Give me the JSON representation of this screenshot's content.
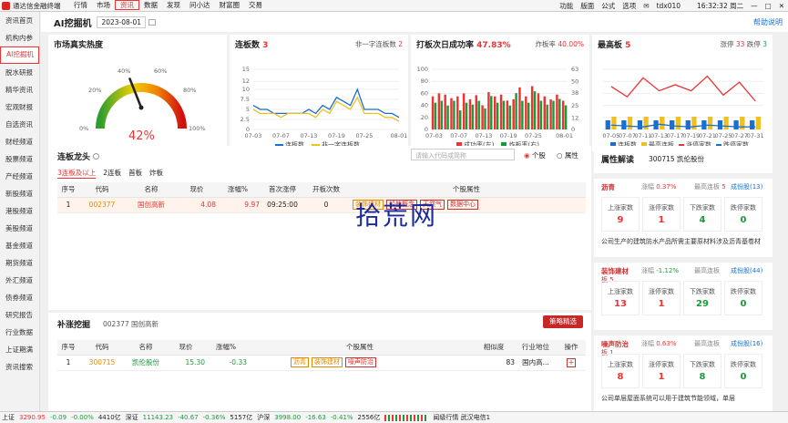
{
  "titlebar": {
    "app_name": "通达信金融终端",
    "menu": [
      "行情",
      "市场",
      "资讯",
      "数据",
      "发现",
      "问小达",
      "财富圈",
      "交易"
    ],
    "right_items": [
      "功能",
      "版面",
      "公式",
      "选项"
    ],
    "account": "tdx010",
    "clock": "16:32:32 周二"
  },
  "sidebar": {
    "items": [
      "资讯首页",
      "机构内参",
      "AI挖掘机",
      "脱水研报",
      "精华资讯",
      "宏观财报",
      "自选资讯",
      "财经频道",
      "股票频道",
      "产经频道",
      "新股频道",
      "港股频道",
      "美股频道",
      "基金频道",
      "期货频道",
      "外汇频道",
      "债券频道",
      "研究报告",
      "行业数据",
      "上证期满",
      "资讯搜索"
    ]
  },
  "topbar": {
    "title": "AI挖掘机",
    "date": "2023-08-01",
    "help": "帮助说明"
  },
  "heat": {
    "title": "市场真实热度",
    "ticks": [
      "0%",
      "20%",
      "40%",
      "60%",
      "80%",
      "100%"
    ],
    "value": "42%",
    "value_num": 42
  },
  "limit_count": {
    "title": "连板数",
    "count": "3",
    "right_label": "非一字连板数",
    "right_count": "2",
    "legend": [
      "连板数",
      "非一字连板数"
    ]
  },
  "next_day": {
    "title": "打板次日成功率",
    "pct": "47.83%",
    "right_label": "炸板率",
    "right_pct": "40.00%",
    "legend": [
      "成功率(左)",
      "炸板率(右)"
    ]
  },
  "highest": {
    "title": "最高板",
    "count": "5",
    "up_label": "涨停",
    "up": "33",
    "down_label": "跌停",
    "down": "3",
    "legend": [
      "连板数",
      "最高连板",
      "涨停家数",
      "跌停家数"
    ]
  },
  "chart_data": [
    {
      "type": "line",
      "title": "连板数",
      "x": [
        "07-03",
        "07-04",
        "07-05",
        "07-06",
        "07-07",
        "07-10",
        "07-11",
        "07-12",
        "07-13",
        "07-14",
        "07-17",
        "07-18",
        "07-19",
        "07-20",
        "07-21",
        "07-24",
        "07-25",
        "07-26",
        "07-27",
        "07-28",
        "07-31",
        "08-01"
      ],
      "xticks": [
        "07-03",
        "07-07",
        "07-13",
        "07-19",
        "07-25",
        "08-01"
      ],
      "ylim": [
        0,
        15
      ],
      "yticks": [
        0,
        2.5,
        5,
        7.5,
        10,
        12,
        15
      ],
      "series": [
        {
          "name": "连板数",
          "color": "#1a6fd0",
          "values": [
            6,
            5,
            5,
            4,
            4,
            4,
            4,
            4,
            5,
            4,
            6,
            5,
            8,
            7,
            6,
            10,
            5,
            5,
            5,
            4,
            4,
            3
          ]
        },
        {
          "name": "非一字连板数",
          "color": "#f0c020",
          "values": [
            5,
            4,
            4,
            4,
            3,
            4,
            4,
            4,
            4,
            3,
            5,
            4,
            7,
            6,
            5,
            8,
            4,
            4,
            4,
            3,
            3,
            2
          ]
        }
      ]
    },
    {
      "type": "bar",
      "title": "打板次日成功率",
      "x": [
        "07-03",
        "07-04",
        "07-05",
        "07-06",
        "07-07",
        "07-10",
        "07-11",
        "07-12",
        "07-13",
        "07-14",
        "07-17",
        "07-18",
        "07-19",
        "07-20",
        "07-21",
        "07-24",
        "07-25",
        "07-26",
        "07-27",
        "07-28",
        "07-31",
        "08-01"
      ],
      "xticks": [
        "07-03",
        "07-07",
        "07-13",
        "07-19",
        "07-25",
        "08-01"
      ],
      "ylim_left": [
        0,
        100
      ],
      "yticks_left": [
        0,
        20,
        40,
        60,
        80,
        100
      ],
      "ylim_right": [
        0,
        63
      ],
      "yticks_right": [
        0,
        12,
        25,
        38,
        50,
        63
      ],
      "series": [
        {
          "name": "成功率(左)",
          "color": "#e33",
          "values": [
            55,
            60,
            58,
            52,
            55,
            60,
            50,
            57,
            40,
            62,
            55,
            58,
            48,
            50,
            70,
            55,
            72,
            60,
            55,
            50,
            58,
            47.83
          ]
        },
        {
          "name": "炸板率(右)",
          "color": "#1a9a3a",
          "values": [
            28,
            30,
            25,
            30,
            20,
            28,
            26,
            30,
            22,
            35,
            28,
            30,
            25,
            38,
            30,
            28,
            40,
            30,
            26,
            30,
            32,
            25.2
          ]
        }
      ]
    },
    {
      "type": "line",
      "title": "最高板",
      "x": [
        "07-05",
        "07-07",
        "07-11",
        "07-13",
        "07-17",
        "07-19",
        "07-21",
        "07-25",
        "07-27",
        "07-31"
      ],
      "series": [
        {
          "name": "涨停家数",
          "color": "#e33",
          "values": [
            50,
            38,
            60,
            45,
            52,
            45,
            62,
            40,
            55,
            33
          ]
        },
        {
          "name": "跌停家数",
          "color": "#1a6fd0",
          "values": [
            5,
            4,
            3,
            6,
            4,
            3,
            5,
            4,
            3,
            3
          ]
        }
      ]
    }
  ],
  "dragon": {
    "title": "连板龙头",
    "search_placeholder": "请输入代码或简称",
    "radio_stock": "个股",
    "radio_attr": "属性",
    "tabs": [
      "3连板及以上",
      "2连板",
      "首板",
      "炸板"
    ],
    "columns": [
      "序号",
      "代码",
      "名称",
      "现价",
      "涨幅%",
      "首次涨停",
      "开板次数",
      "个股属性"
    ],
    "rows": [
      {
        "idx": "1",
        "code": "002377",
        "name": "国创高新",
        "price": "4.08",
        "chg": "9.97",
        "first": "09:25:00",
        "opens": "0",
        "tags": [
          "装饰建材",
          "船舶概念",
          "天然气",
          "数据中心"
        ]
      }
    ]
  },
  "supplement": {
    "title": "补涨挖掘",
    "subtitle": "002377 国创高新",
    "button": "策略精选",
    "columns": [
      "序号",
      "代码",
      "名称",
      "现价",
      "涨幅%",
      "个股属性",
      "相似度",
      "行业地位",
      "操作"
    ],
    "rows": [
      {
        "idx": "1",
        "code": "300715",
        "name": "凯伦股份",
        "price": "15.30",
        "chg": "-0.33",
        "tags": [
          "沥青",
          "装饰建材",
          "噪声防治"
        ],
        "sim": "83",
        "rank": "国内高...",
        "op": "+"
      }
    ]
  },
  "attr": {
    "title": "属性解读",
    "stock": "300715 凯伦股份",
    "blocks": [
      {
        "name": "沥青",
        "chg_label": "涨幅",
        "chg": "0.37%",
        "high_label": "最高连板",
        "high": "5",
        "link": "成份股(13)",
        "stats": [
          {
            "l": "上涨家数",
            "v": "9",
            "c": "red"
          },
          {
            "l": "涨停家数",
            "v": "1",
            "c": "red"
          },
          {
            "l": "下跌家数",
            "v": "4",
            "c": "green"
          },
          {
            "l": "跌停家数",
            "v": "0",
            "c": "green"
          }
        ],
        "desc": "公司生产的建筑防水产品所需主要原材料涉及沥青基卷材"
      },
      {
        "name": "装饰建材",
        "sub": "板 5",
        "chg_label": "涨幅",
        "chg": "-1.12%",
        "high_label": "最高连板",
        "high": "",
        "link": "成份股(44)",
        "stats": [
          {
            "l": "上涨家数",
            "v": "13",
            "c": "red"
          },
          {
            "l": "涨停家数",
            "v": "1",
            "c": "red"
          },
          {
            "l": "下跌家数",
            "v": "29",
            "c": "green"
          },
          {
            "l": "跌停家数",
            "v": "0",
            "c": "green"
          }
        ],
        "desc": ""
      },
      {
        "name": "噪声防治",
        "sub": "板 1",
        "chg_label": "涨幅",
        "chg": "0.63%",
        "high_label": "最高连板",
        "high": "",
        "link": "成份股(16)",
        "stats": [
          {
            "l": "上涨家数",
            "v": "8",
            "c": "red"
          },
          {
            "l": "涨停家数",
            "v": "1",
            "c": "red"
          },
          {
            "l": "下跌家数",
            "v": "8",
            "c": "green"
          },
          {
            "l": "跌停家数",
            "v": "0",
            "c": "green"
          }
        ],
        "desc": "公司单层屋面系统可以用于建筑节能领域，单层"
      }
    ]
  },
  "statusbar": {
    "sh": "上证",
    "sh_val": "3290.95",
    "sh_chg": "-0.09",
    "sh_pct": "-0.00%",
    "sh_amt": "4410亿",
    "sz": "深证",
    "sz_val": "11143.23",
    "sz_chg": "-40.67",
    "sz_pct": "-0.36%",
    "sz_amt": "5157亿",
    "hs": "沪深",
    "hs_val": "3998.00",
    "hs_chg": "-16.63",
    "hs_pct": "-0.41%",
    "hs_amt": "2556亿",
    "right": "闻级行情 武汉电信1"
  },
  "watermark": "拾荒网"
}
